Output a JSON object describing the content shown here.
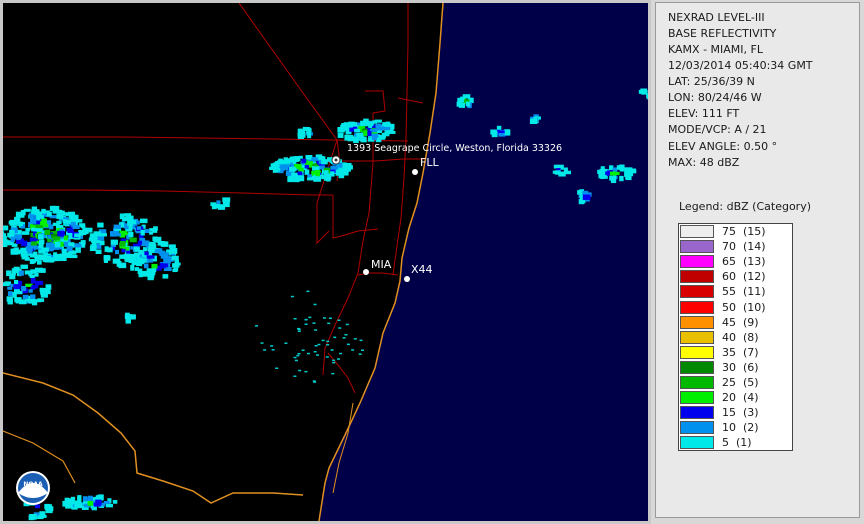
{
  "info": {
    "product": "NEXRAD LEVEL-III",
    "type": "BASE REFLECTIVITY",
    "station": "KAMX - MIAMI, FL",
    "datetime": "12/03/2014 05:40:34 GMT",
    "lat": "LAT: 25/36/39 N",
    "lon": "LON: 80/24/46 W",
    "elev": "ELEV: 111 FT",
    "mode": "MODE/VCP: A / 21",
    "elev_angle": "ELEV ANGLE: 0.50 °",
    "max": "MAX: 48 dBZ"
  },
  "legend": {
    "title": "Legend: dBZ (Category)",
    "items": [
      {
        "label": "75  (15)",
        "color": "#eeeeee"
      },
      {
        "label": "70  (14)",
        "color": "#9966cc"
      },
      {
        "label": "65  (13)",
        "color": "#ff00ff"
      },
      {
        "label": "60  (12)",
        "color": "#c00000"
      },
      {
        "label": "55  (11)",
        "color": "#d80000"
      },
      {
        "label": "50  (10)",
        "color": "#ff0000"
      },
      {
        "label": "45  (9)",
        "color": "#ff9000"
      },
      {
        "label": "40  (8)",
        "color": "#e8c000"
      },
      {
        "label": "35  (7)",
        "color": "#ffff00"
      },
      {
        "label": "30  (6)",
        "color": "#008800"
      },
      {
        "label": "25  (5)",
        "color": "#00b800"
      },
      {
        "label": "20  (4)",
        "color": "#00ee00"
      },
      {
        "label": "15  (3)",
        "color": "#0000ee"
      },
      {
        "label": "10  (2)",
        "color": "#0090ee"
      },
      {
        "label": "5  (1)",
        "color": "#00e8e8"
      }
    ]
  },
  "map": {
    "location_label": "1393 Seagrape Circle, Weston, Florida 33326",
    "airports": [
      "FLL",
      "MIA",
      "X44"
    ],
    "ocean_color": "#000048",
    "land_color": "#000000",
    "road_color": "#b00000",
    "coast_color": "#e09020",
    "logo_text": "NOAA"
  }
}
